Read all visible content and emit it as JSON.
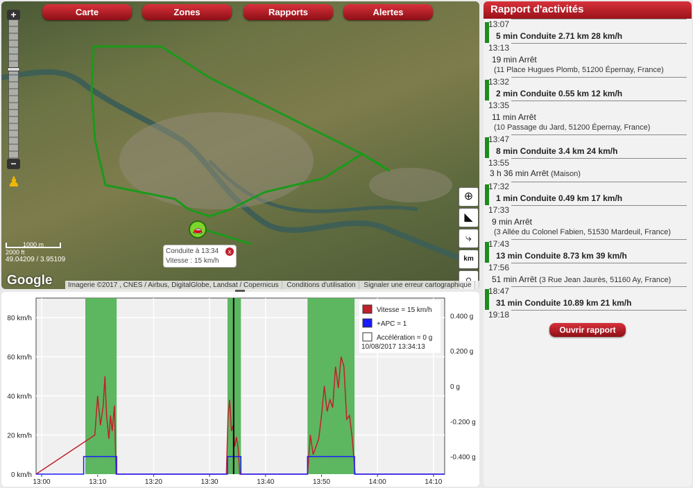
{
  "nav": {
    "tabs": [
      {
        "label": "Carte"
      },
      {
        "label": "Zones"
      },
      {
        "label": "Rapports"
      },
      {
        "label": "Alertes"
      }
    ]
  },
  "map": {
    "scale_1": "1000 m",
    "scale_2": "2000 ft",
    "coords": "49.04209 / 3.95109",
    "logo": "Google",
    "attribution": [
      "Imagerie ©2017 , CNES / Airbus, DigitalGlobe, Landsat / Copernicus",
      "Conditions d'utilisation",
      "Signaler une erreur cartographique"
    ],
    "popup": {
      "line1": "Conduite à 13:34",
      "line2": "Vitesse : 15 km/h",
      "close": "x"
    },
    "zoom_in": "+",
    "zoom_out": "−",
    "controls": {
      "km": "km"
    }
  },
  "sidebar": {
    "title": "Rapport d'activités",
    "open_button": "Ouvrir rapport",
    "times": [
      "13:07",
      "13:13",
      "13:32",
      "13:35",
      "13:47",
      "13:55",
      "17:32",
      "17:33",
      "17:43",
      "17:56",
      "18:47",
      "19:18"
    ],
    "entries": [
      {
        "type": "drive",
        "duration": "5 min",
        "label": "Conduite",
        "distance": "2.71 km",
        "speed": "28 km/h"
      },
      {
        "type": "stop",
        "duration": "19 min",
        "label": "Arrêt",
        "address": "(11 Place Hugues Plomb, 51200 Épernay, France)"
      },
      {
        "type": "drive",
        "duration": "2 min",
        "label": "Conduite",
        "distance": "0.55 km",
        "speed": "12 km/h"
      },
      {
        "type": "stop",
        "duration": "11 min",
        "label": "Arrêt",
        "address": "(10 Passage du Jard, 51200 Épernay, France)"
      },
      {
        "type": "drive",
        "duration": "8 min",
        "label": "Conduite",
        "distance": "3.4 km",
        "speed": "24 km/h"
      },
      {
        "type": "stop",
        "duration": "3 h 36 min",
        "label": "Arrêt",
        "address": "(Maison)"
      },
      {
        "type": "drive",
        "duration": "1 min",
        "label": "Conduite",
        "distance": "0.49 km",
        "speed": "17 km/h"
      },
      {
        "type": "stop",
        "duration": "9 min",
        "label": "Arrêt",
        "address": "(3 Allée du Colonel Fabien, 51530 Mardeuil, France)"
      },
      {
        "type": "drive",
        "duration": "13 min",
        "label": "Conduite",
        "distance": "8.73 km",
        "speed": "39 km/h"
      },
      {
        "type": "stop",
        "duration": "51 min",
        "label": "Arrêt",
        "address": "(3 Rue Jean Jaurès, 51160 Ay, France)"
      },
      {
        "type": "drive",
        "duration": "31 min",
        "label": "Conduite",
        "distance": "10.89 km",
        "speed": "21 km/h"
      }
    ]
  },
  "colors": {
    "brand": "#c0202b",
    "drive": "#1c8c1c",
    "speed": "#c0202b",
    "apc": "#1a1aff",
    "active_band": "#4caf50"
  },
  "chart_data": {
    "type": "line",
    "x_ticks": [
      "13:00",
      "13:10",
      "13:20",
      "13:30",
      "13:40",
      "13:50",
      "14:00",
      "14:10"
    ],
    "x_range_min": [
      -1,
      72
    ],
    "y_left_ticks": [
      "0 km/h",
      "20 km/h",
      "40 km/h",
      "60 km/h",
      "80 km/h"
    ],
    "y_left_range": [
      0,
      90
    ],
    "y_right_ticks": [
      "-0.400 g",
      "-0.200 g",
      "0 g",
      "0.200 g",
      "0.400 g"
    ],
    "y_right_range": [
      -0.5,
      0.5
    ],
    "active_periods_min": [
      [
        7.8,
        13.4
      ],
      [
        33.2,
        35.6
      ],
      [
        47.5,
        55.9
      ]
    ],
    "cursor_min": 34.3,
    "legend": [
      {
        "label": "Vitesse = 15 km/h",
        "color": "#c0202b"
      },
      {
        "label": "+APC = 1",
        "color": "#1a1aff"
      },
      {
        "label": "Accélération = 0 g",
        "color": "#ffffff"
      }
    ],
    "timestamp": "10/08/2017 13:34:13",
    "series": [
      {
        "name": "Vitesse",
        "x": [
          -1,
          9.5,
          10,
          10.5,
          11,
          11.3,
          11.6,
          12,
          12.3,
          12.6,
          13,
          13.3,
          33,
          33.3,
          33.6,
          33.9,
          34.2,
          34.5,
          34.8,
          35.1,
          35.4,
          47.5,
          48,
          48.5,
          49,
          49.5,
          50,
          50.5,
          51,
          51.5,
          52,
          52.5,
          53,
          53.5,
          54,
          54.5,
          55,
          55.5,
          56,
          72
        ],
        "values": [
          0,
          20,
          40,
          25,
          35,
          50,
          30,
          18,
          30,
          22,
          35,
          0,
          0,
          30,
          38,
          22,
          25,
          14,
          19,
          13,
          0,
          0,
          20,
          10,
          14,
          18,
          30,
          45,
          32,
          38,
          34,
          55,
          44,
          60,
          55,
          28,
          30,
          18,
          0,
          0
        ]
      },
      {
        "name": "+APC",
        "x": [
          -1,
          7.5,
          7.5,
          13.4,
          13.4,
          33.2,
          33.2,
          35.6,
          35.6,
          47.5,
          47.5,
          55.9,
          55.9,
          72
        ],
        "values": [
          0,
          0,
          9,
          9,
          0,
          0,
          9,
          9,
          0,
          0,
          9,
          9,
          0,
          0
        ]
      }
    ]
  }
}
